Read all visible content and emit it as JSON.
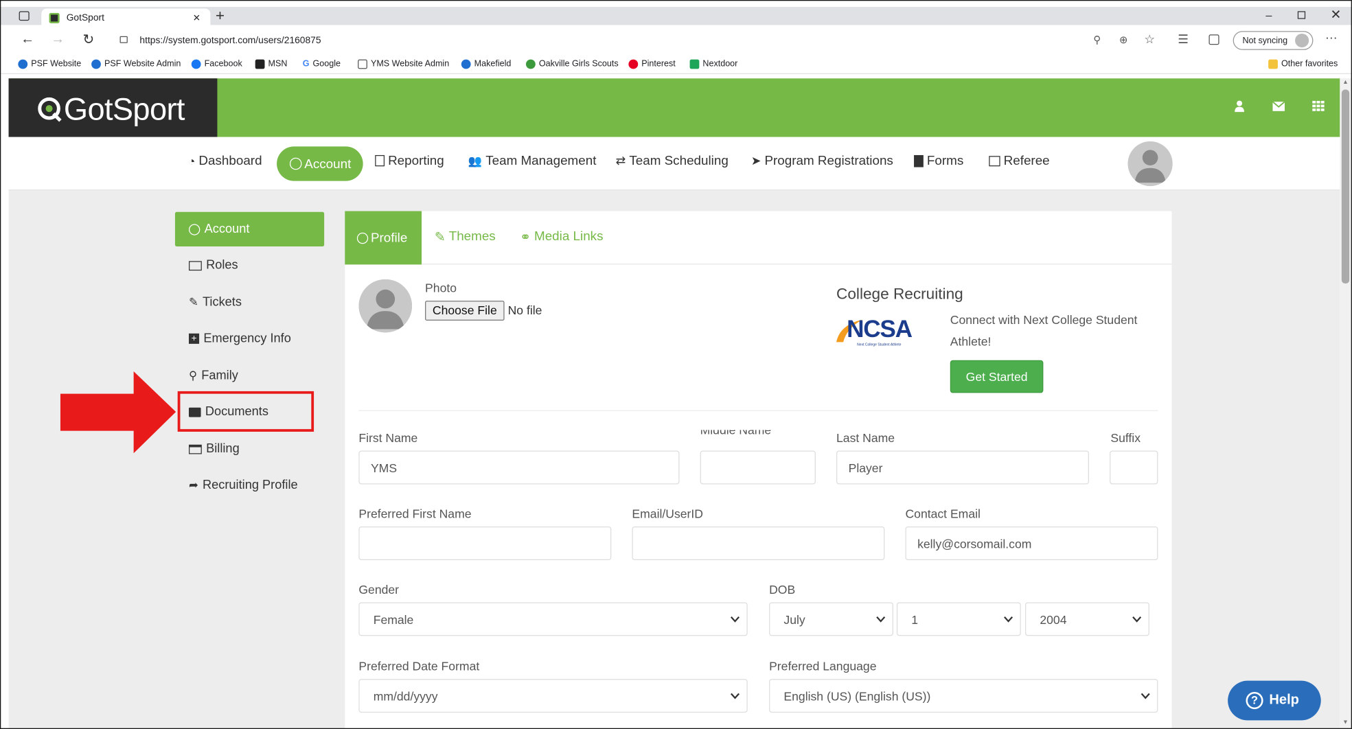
{
  "browser": {
    "tab_title": "GotSport",
    "url": "https://system.gotsport.com/users/2160875",
    "sync_label": "Not syncing",
    "bookmarks": [
      "PSF Website",
      "PSF Website Admin",
      "Facebook",
      "MSN",
      "Google",
      "YMS Website Admin",
      "Makefield",
      "Oakville Girls Scouts",
      "Pinterest",
      "Nextdoor"
    ],
    "other_favorites": "Other favorites"
  },
  "site": {
    "logo_text": "GotSport",
    "brand_color": "#76b947"
  },
  "nav": {
    "items": [
      "Dashboard",
      "Account",
      "Reporting",
      "Team Management",
      "Team Scheduling",
      "Program Registrations",
      "Forms",
      "Referee"
    ],
    "active": "Account"
  },
  "sidebar": {
    "items": [
      "Account",
      "Roles",
      "Tickets",
      "Emergency Info",
      "Family",
      "Documents",
      "Billing",
      "Recruiting Profile"
    ],
    "active": "Account",
    "highlighted": "Documents"
  },
  "tabs": {
    "items": [
      "Profile",
      "Themes",
      "Media Links"
    ],
    "active": "Profile"
  },
  "profile": {
    "photo_label": "Photo",
    "choose_file": "Choose File",
    "no_file": "No file",
    "college_title": "College Recruiting",
    "ncsa_logo": "NCSA",
    "ncsa_tag": "Next College Student Athlete",
    "college_text": "Connect with Next College Student Athlete!",
    "get_started": "Get Started"
  },
  "form": {
    "first_name_label": "First Name",
    "first_name": "YMS",
    "middle_name_label": "Middle Name",
    "middle_name": "",
    "last_name_label": "Last Name",
    "last_name": "Player",
    "suffix_label": "Suffix",
    "suffix": "",
    "preferred_first_label": "Preferred First Name",
    "preferred_first": "",
    "email_label": "Email/UserID",
    "email": "",
    "contact_email_label": "Contact Email",
    "contact_email": "kelly@corsomail.com",
    "gender_label": "Gender",
    "gender": "Female",
    "dob_label": "DOB",
    "dob_month": "July",
    "dob_day": "1",
    "dob_year": "2004",
    "date_format_label": "Preferred Date Format",
    "date_format": "mm/dd/yyyy",
    "language_label": "Preferred Language",
    "language": "English (US) (English (US))"
  },
  "help": {
    "label": "Help"
  },
  "colors": {
    "accent": "#76b947",
    "annotation": "#e81a1a",
    "help": "#2a6ebb"
  }
}
